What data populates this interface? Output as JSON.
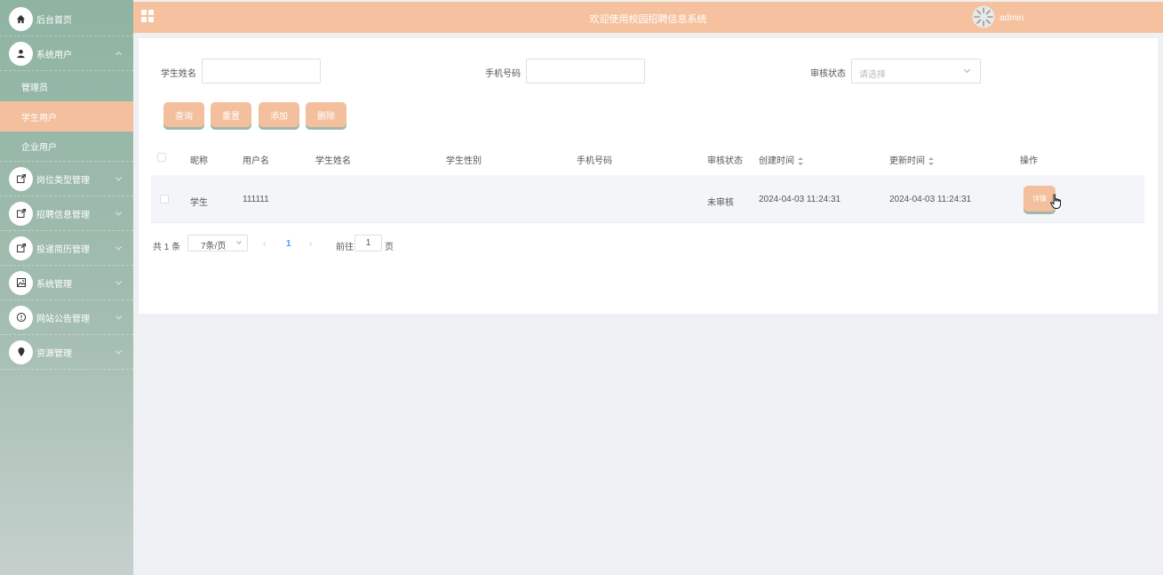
{
  "header": {
    "title": "欢迎使用校园招聘信息系统",
    "user": "admin"
  },
  "sidebar": {
    "home": "后台首页",
    "system_users": "系统用户",
    "sub_items": [
      "管理员",
      "学生用户",
      "企业用户"
    ],
    "menus": [
      "岗位类型管理",
      "招聘信息管理",
      "投递简历管理",
      "系统管理",
      "网站公告管理",
      "资源管理"
    ]
  },
  "search": {
    "student_name_label": "学生姓名",
    "phone_label": "手机号码",
    "status_label": "审核状态",
    "status_placeholder": "请选择"
  },
  "buttons": {
    "query": "查询",
    "reset": "重置",
    "add": "添加",
    "delete": "删除"
  },
  "table": {
    "headers": [
      "昵称",
      "用户名",
      "学生姓名",
      "学生性别",
      "手机号码",
      "审核状态",
      "创建时间",
      "更新时间",
      "操作"
    ],
    "rows": [
      {
        "nickname": "学生",
        "username": "111111",
        "name": "",
        "gender": "",
        "phone": "",
        "status": "未审核",
        "created": "2024-04-03 11:24:31",
        "updated": "2024-04-03 11:24:31",
        "action": "详情"
      }
    ]
  },
  "pagination": {
    "total": "共 1 条",
    "page_size": "7条/页",
    "current": "1",
    "goto_label": "前往",
    "goto_value": "1",
    "page_unit": "页"
  },
  "colors": {
    "accent": "#f4bf9c",
    "sidebar": "#8fb4a2",
    "active_page": "#409eff"
  }
}
